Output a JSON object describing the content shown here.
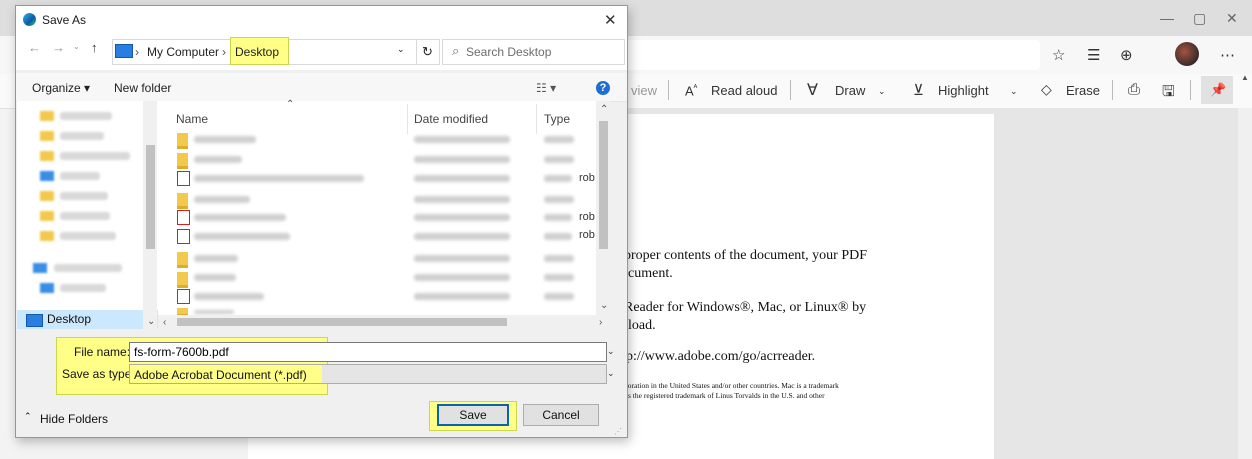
{
  "browser": {
    "window_controls": {
      "minimize": "—",
      "maximize": "▢",
      "close": "✕"
    },
    "toolbar": {
      "view_fragment": "view",
      "read_aloud": "Read aloud",
      "draw": "Draw",
      "highlight": "Highlight",
      "erase": "Erase"
    },
    "pdf_text": {
      "line1": "proper contents of the document, your PDF",
      "line2": "cument.",
      "line3": "Reader for Windows®, Mac, or Linux® by",
      "line4": "load.",
      "line5": "p://www.adobe.com/go/acrreader.",
      "line6": "poration in the United States and/or other countries. Mac is a trademark",
      "line7": "s the registered trademark of Linus Torvalds in the U.S. and other"
    }
  },
  "dialog": {
    "title": "Save As",
    "close": "✕",
    "breadcrumb": {
      "root": "My Computer",
      "separator": "›",
      "current": "Desktop"
    },
    "search_placeholder": "Search Desktop",
    "toolbar": {
      "organize": "Organize ▾",
      "new_folder": "New folder",
      "view": "☷ ▾",
      "help": "?"
    },
    "columns": {
      "name": "Name",
      "date_modified": "Date modified",
      "type": "Type"
    },
    "type_fragments": [
      "rob",
      "rob",
      "rob"
    ],
    "nav_selected": "Desktop",
    "file_name_label": "File name:",
    "file_name_value": "fs-form-7600b.pdf",
    "save_as_type_label": "Save as type:",
    "save_as_type_value": "Adobe Acrobat Document (*.pdf)",
    "hide_folders": "Hide Folders",
    "save": "Save",
    "cancel": "Cancel"
  },
  "colors": {
    "highlight": "#ffff88",
    "accent": "#0a64ad"
  }
}
